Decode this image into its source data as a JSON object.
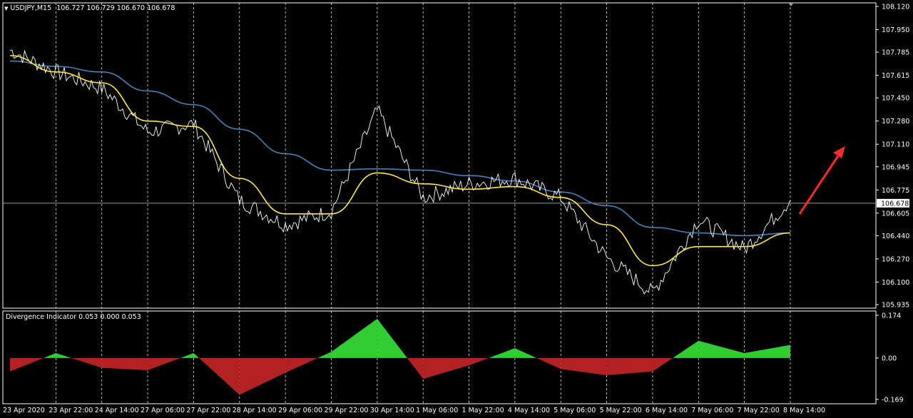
{
  "main_chart": {
    "symbol": "USDJPY,M15",
    "ohlc": "106.727 106.729 106.670 106.678",
    "current_price": "106.678",
    "y_labels": [
      "108.120",
      "107.950",
      "107.785",
      "107.615",
      "107.450",
      "107.280",
      "107.110",
      "106.945",
      "106.775",
      "106.605",
      "106.440",
      "106.270",
      "106.100",
      "105.935"
    ],
    "colors": {
      "price": "#ffffff",
      "up_candle": "#32cd32",
      "fast_ma": "#ffeb3b",
      "slow_ma": "#4682b4",
      "current_line": "#9a9a9a",
      "arrow": "#ff2a2a",
      "grid": "#ffffff"
    }
  },
  "indicator": {
    "title": "Divergence Indicator 0.053 0.000 0.053",
    "y_labels": [
      "0.174",
      "0.00",
      "-0.169"
    ],
    "colors": {
      "positive": "#32cd32",
      "negative": "#b22222"
    }
  },
  "x_labels": [
    "23 Apr 2020",
    "23 Apr 22:00",
    "24 Apr 14:00",
    "27 Apr 06:00",
    "27 Apr 22:00",
    "28 Apr 14:00",
    "29 Apr 06:00",
    "29 Apr 22:00",
    "30 Apr 14:00",
    "1 May 06:00",
    "1 May 22:00",
    "4 May 14:00",
    "5 May 06:00",
    "5 May 22:00",
    "6 May 14:00",
    "7 May 06:00",
    "7 May 22:00",
    "8 May 14:00"
  ],
  "chart_data": [
    {
      "type": "line",
      "title": "USDJPY,M15",
      "ylim": [
        105.935,
        108.12
      ],
      "x": [
        "23 Apr 2020",
        "23 Apr 22:00",
        "24 Apr 14:00",
        "27 Apr 06:00",
        "27 Apr 22:00",
        "28 Apr 14:00",
        "29 Apr 06:00",
        "29 Apr 22:00",
        "30 Apr 14:00",
        "1 May 06:00",
        "1 May 22:00",
        "4 May 14:00",
        "5 May 06:00",
        "5 May 22:00",
        "6 May 14:00",
        "7 May 06:00",
        "7 May 22:00",
        "8 May 14:00"
      ],
      "series": [
        {
          "values": [
            107.8,
            107.64,
            107.52,
            107.2,
            107.26,
            106.7,
            106.52,
            106.62,
            107.36,
            106.72,
            106.82,
            106.86,
            106.72,
            106.28,
            106.02,
            106.56,
            106.34,
            106.7
          ]
        },
        {
          "values": [
            107.76,
            107.64,
            107.56,
            107.28,
            107.24,
            106.86,
            106.6,
            106.6,
            106.9,
            106.82,
            106.78,
            106.8,
            106.72,
            106.52,
            106.22,
            106.36,
            106.36,
            106.46
          ]
        },
        {
          "values": [
            107.72,
            107.68,
            107.64,
            107.5,
            107.4,
            107.22,
            107.04,
            106.92,
            106.93,
            106.92,
            106.88,
            106.84,
            106.76,
            106.66,
            106.5,
            106.46,
            106.44,
            106.46
          ]
        }
      ],
      "grid": true
    },
    {
      "type": "area",
      "title": "Divergence Indicator 0.053 0.000 0.053",
      "ylim": [
        -0.169,
        0.174
      ],
      "x": [
        "23 Apr 2020",
        "23 Apr 22:00",
        "24 Apr 14:00",
        "27 Apr 06:00",
        "27 Apr 22:00",
        "28 Apr 14:00",
        "29 Apr 06:00",
        "29 Apr 22:00",
        "30 Apr 14:00",
        "1 May 06:00",
        "1 May 22:00",
        "4 May 14:00",
        "5 May 06:00",
        "5 May 22:00",
        "6 May 14:00",
        "7 May 06:00",
        "7 May 22:00",
        "8 May 14:00"
      ],
      "series": [
        {
          "values": [
            -0.055,
            0.02,
            -0.04,
            -0.05,
            0.02,
            -0.15,
            -0.06,
            0.025,
            0.16,
            -0.085,
            -0.03,
            0.04,
            -0.045,
            -0.07,
            -0.055,
            0.07,
            0.02,
            0.053
          ]
        }
      ]
    }
  ]
}
